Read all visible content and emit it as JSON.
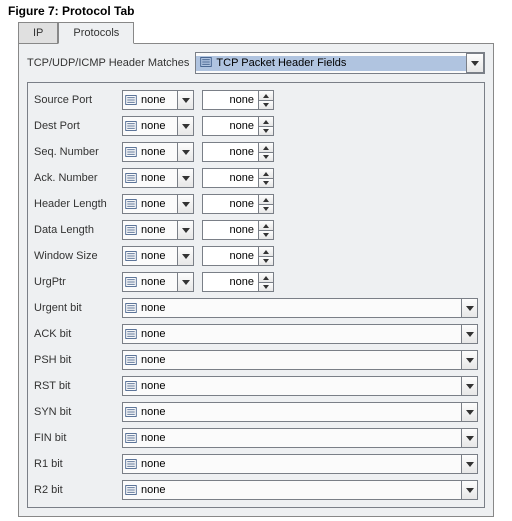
{
  "figure_title": "Figure 7:  Protocol Tab",
  "tabs": {
    "ip": "IP",
    "protocols": "Protocols"
  },
  "header": {
    "label": "TCP/UDP/ICMP Header Matches",
    "value": "TCP Packet Header Fields"
  },
  "none": "none",
  "numeric_rows": [
    {
      "label": "Source Port"
    },
    {
      "label": "Dest Port"
    },
    {
      "label": "Seq. Number"
    },
    {
      "label": "Ack. Number"
    },
    {
      "label": "Header Length"
    },
    {
      "label": "Data Length"
    },
    {
      "label": "Window Size"
    },
    {
      "label": "UrgPtr"
    }
  ],
  "bit_rows": [
    {
      "label": "Urgent bit"
    },
    {
      "label": "ACK bit"
    },
    {
      "label": "PSH bit"
    },
    {
      "label": "RST bit"
    },
    {
      "label": "SYN bit"
    },
    {
      "label": "FIN bit"
    },
    {
      "label": "R1 bit"
    },
    {
      "label": "R2 bit"
    }
  ]
}
